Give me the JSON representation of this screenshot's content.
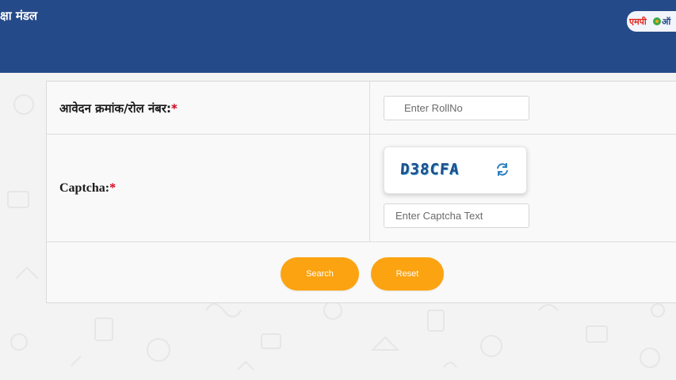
{
  "header": {
    "title": "क्षा मंडल",
    "logo_name": "mp-online-logo",
    "brand_color": "#254a8a"
  },
  "form": {
    "roll_label": "आवेदन क्रमांक/रोल नंबर:",
    "roll_required_mark": "*",
    "roll_placeholder": "Enter RollNo",
    "roll_value": "",
    "captcha_label": "Captcha:",
    "captcha_required_mark": "*",
    "captcha_code": "D38CFA",
    "captcha_placeholder": "Enter Captcha Text",
    "captcha_value": "",
    "refresh_icon": "refresh-icon"
  },
  "buttons": {
    "search_label": "Search",
    "reset_label": "Reset",
    "button_color": "#fca311"
  }
}
